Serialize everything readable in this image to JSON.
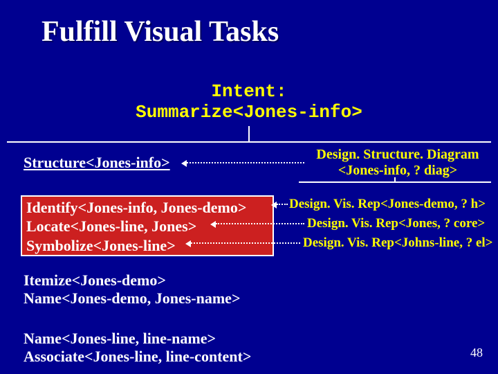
{
  "title": "Fulfill Visual Tasks",
  "intent": {
    "line1": "Intent:",
    "line2": "Summarize<Jones-info>"
  },
  "left": {
    "structure": "Structure<Jones-info>",
    "redbox": {
      "l1": "Identify<Jones-info, Jones-demo>",
      "l2": "Locate<Jones-line, Jones>",
      "l3": "Symbolize<Jones-line>"
    },
    "group2": {
      "l1": "Itemize<Jones-demo>",
      "l2": "Name<Jones-demo, Jones-name>"
    },
    "group3": {
      "l1": "Name<Jones-line, line-name>",
      "l2": "Associate<Jones-line, line-content>"
    }
  },
  "right": {
    "diagram": {
      "l1": "Design. Structure. Diagram",
      "l2": "<Jones-info, ? diag>"
    },
    "r1": "Design. Vis. Rep<Jones-demo, ? h>",
    "r2": "Design. Vis. Rep<Jones, ? core>",
    "r3": "Design. Vis. Rep<Johns-line, ? el>"
  },
  "page": "48"
}
